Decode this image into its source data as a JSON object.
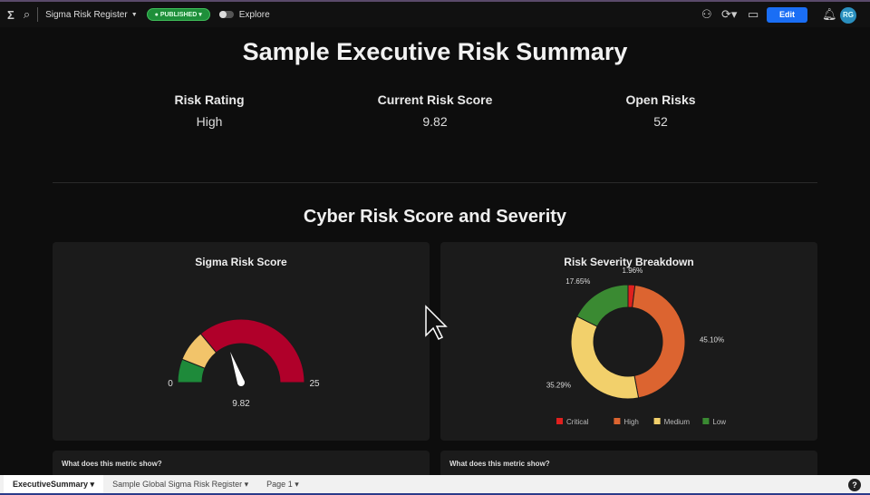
{
  "topbar": {
    "workbook": "Sigma Risk Register",
    "status": "PUBLISHED",
    "explore": "Explore",
    "edit": "Edit",
    "avatar": "RG"
  },
  "title": "Sample Executive Risk Summary",
  "kpis": [
    {
      "label": "Risk Rating",
      "value": "High"
    },
    {
      "label": "Current Risk Score",
      "value": "9.82"
    },
    {
      "label": "Open Risks",
      "value": "52"
    }
  ],
  "section_title": "Cyber Risk Score and Severity",
  "chart_data": [
    {
      "type": "gauge",
      "title": "Sigma Risk Score",
      "min": 0,
      "max": 25,
      "value": 9.82,
      "min_label": "0",
      "max_label": "25",
      "value_label": "9.82",
      "bands": [
        {
          "to": 3,
          "color": "#1e8a3a"
        },
        {
          "to": 7,
          "color": "#f2c46a"
        },
        {
          "to": 25,
          "color": "#b0002a"
        }
      ]
    },
    {
      "type": "pie",
      "title": "Risk Severity Breakdown",
      "donut": true,
      "categories": [
        "Critical",
        "High",
        "Medium",
        "Low"
      ],
      "values": [
        1.96,
        45.1,
        35.29,
        17.65
      ],
      "labels": [
        "1.96%",
        "45.10%",
        "35.29%",
        "17.65%"
      ],
      "colors": [
        "#e0201e",
        "#dc6430",
        "#f2d06b",
        "#3a8a32"
      ],
      "legend": "bottom"
    }
  ],
  "cards_footer": [
    "What does  this metric show?",
    "What does  this metric show?"
  ],
  "bottom_tabs": [
    "ExecutiveSummary",
    "Sample Global Sigma Risk Register",
    "Page 1"
  ],
  "help": "?"
}
